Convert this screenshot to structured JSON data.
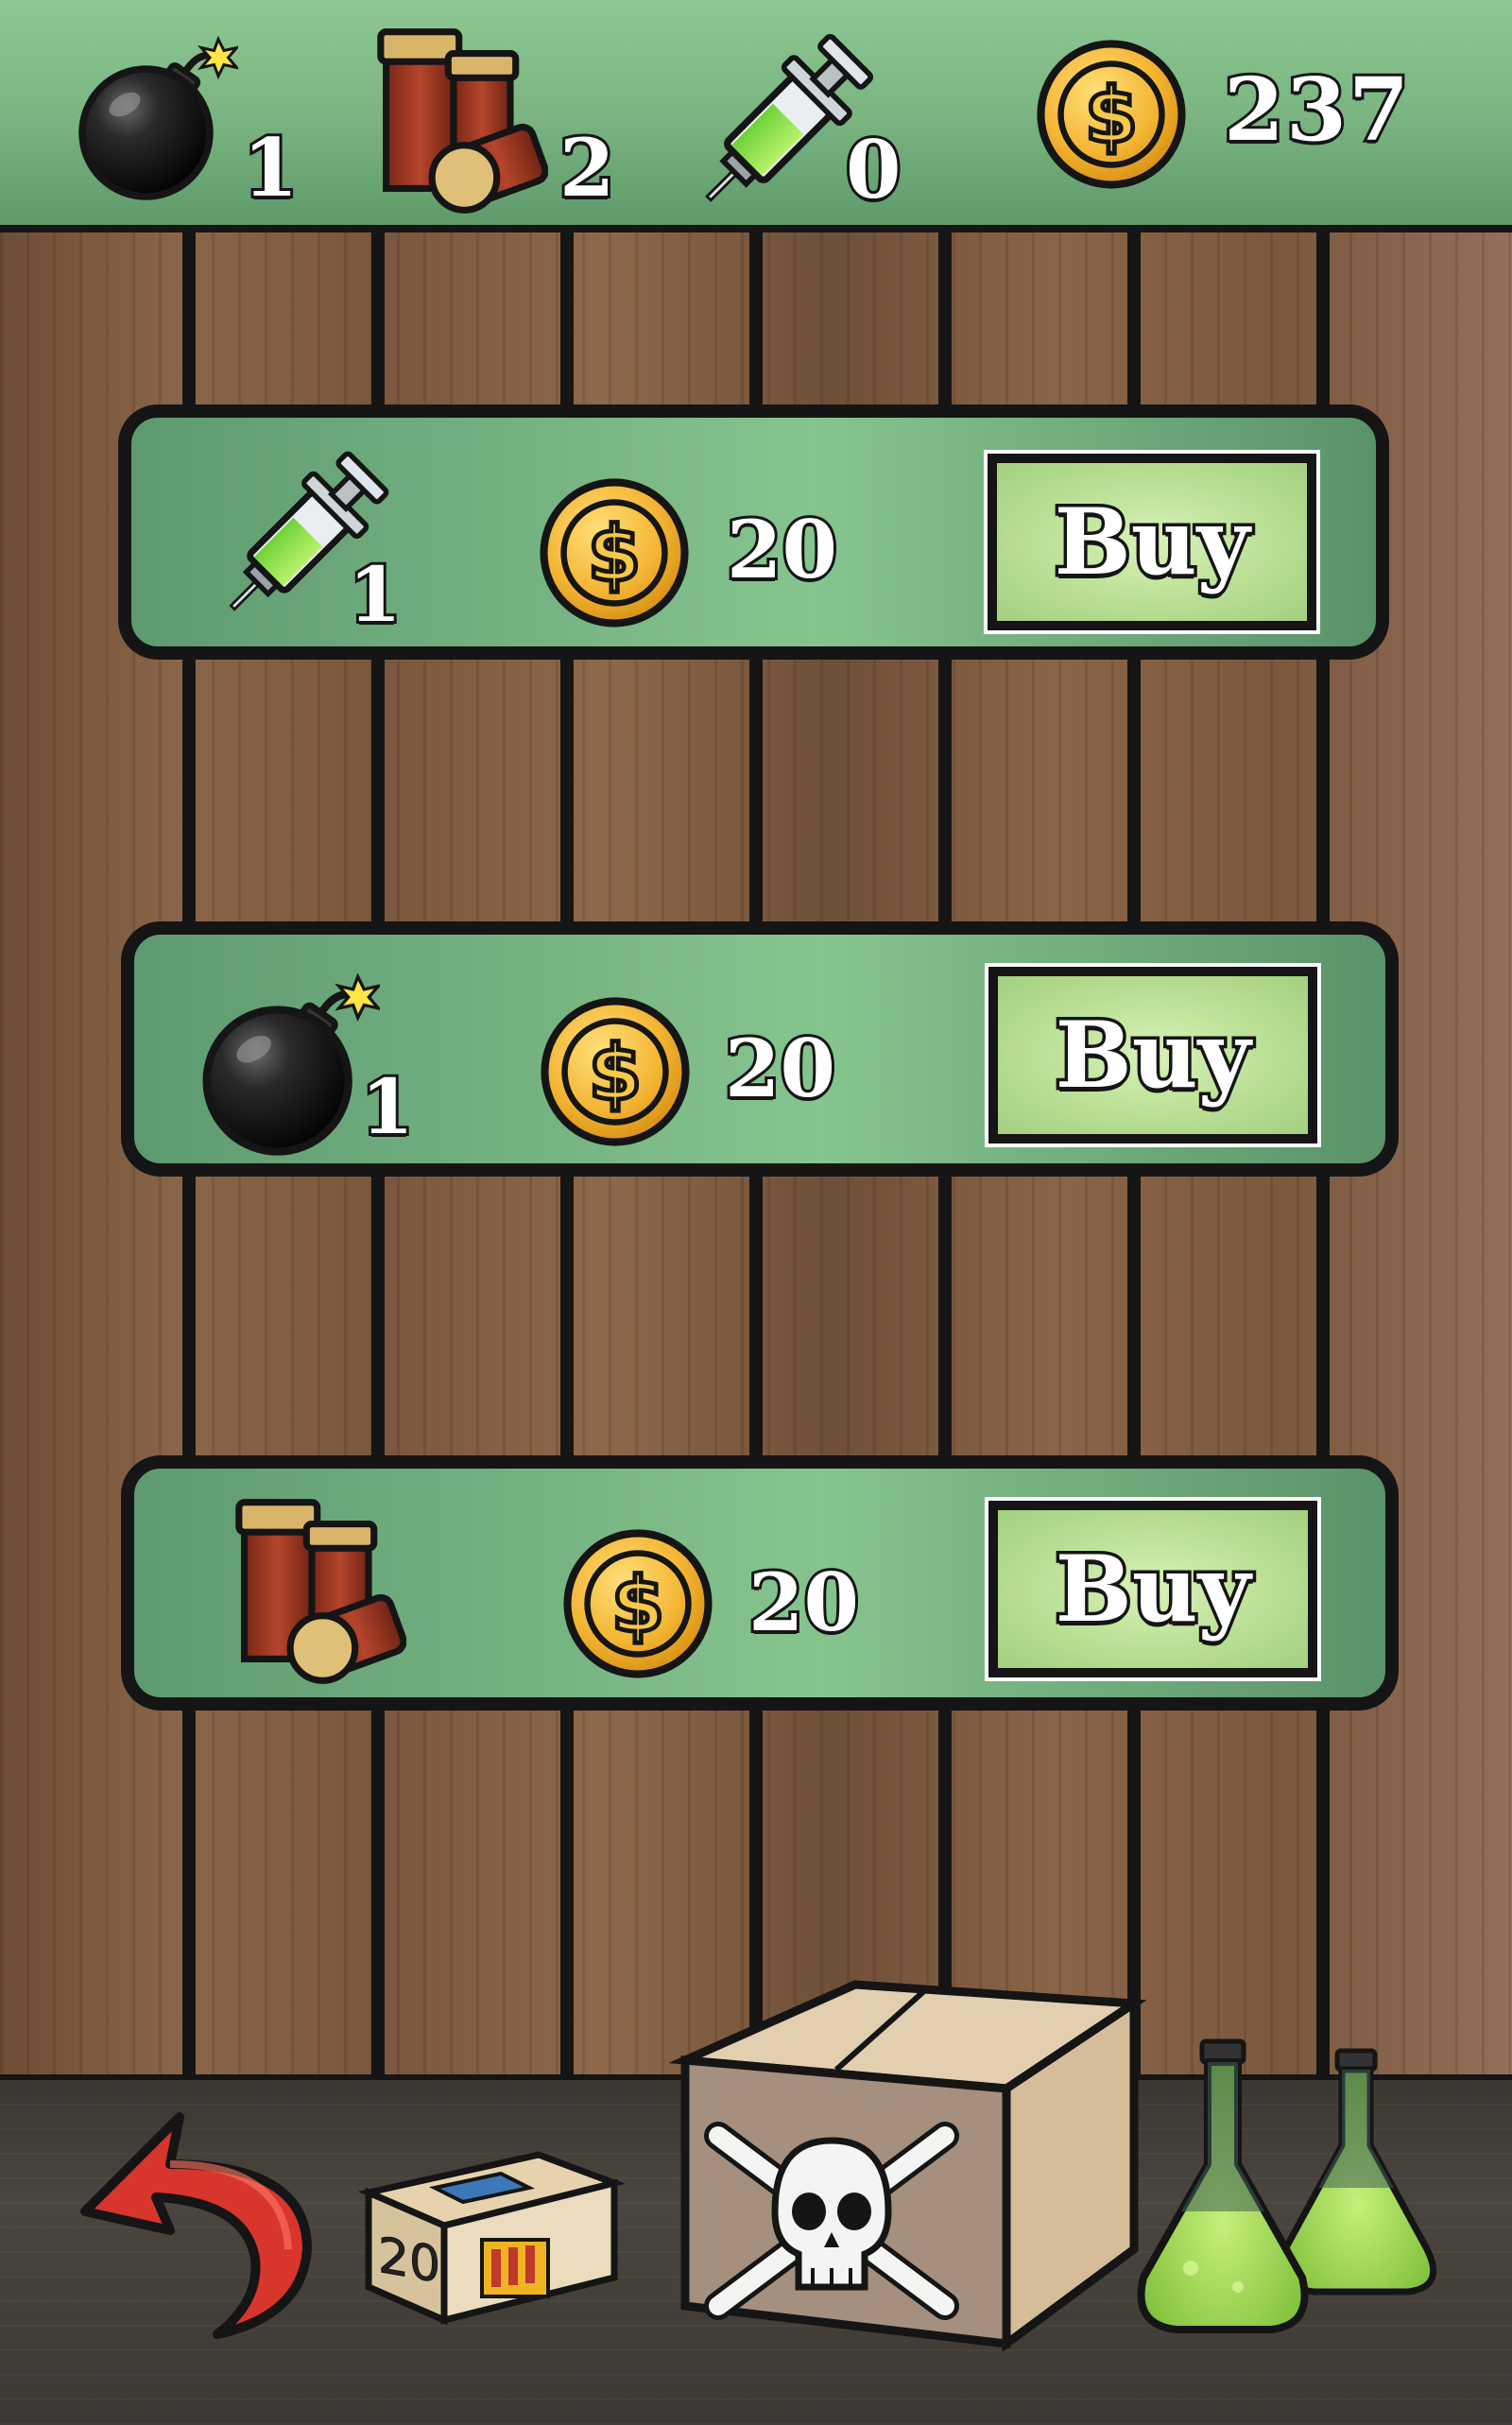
{
  "hud": {
    "bomb_count": "1",
    "shells_count": "2",
    "syringe_count": "0",
    "coins": "237"
  },
  "shop": {
    "items": [
      {
        "icon": "syringe-icon",
        "quantity": "1",
        "price": "20",
        "button_label": "Buy"
      },
      {
        "icon": "bomb-icon",
        "quantity": "1",
        "price": "20",
        "button_label": "Buy"
      },
      {
        "icon": "shotgun-shells-icon",
        "quantity": "",
        "price": "20",
        "button_label": "Buy"
      }
    ]
  },
  "decor": {
    "ammo_box_number": "20"
  },
  "colors": {
    "panel_green": "#86c48f",
    "button_green": "#b9df94",
    "coin_gold": "#f2b233",
    "outline": "#151515",
    "back_arrow_red": "#c8302a"
  }
}
